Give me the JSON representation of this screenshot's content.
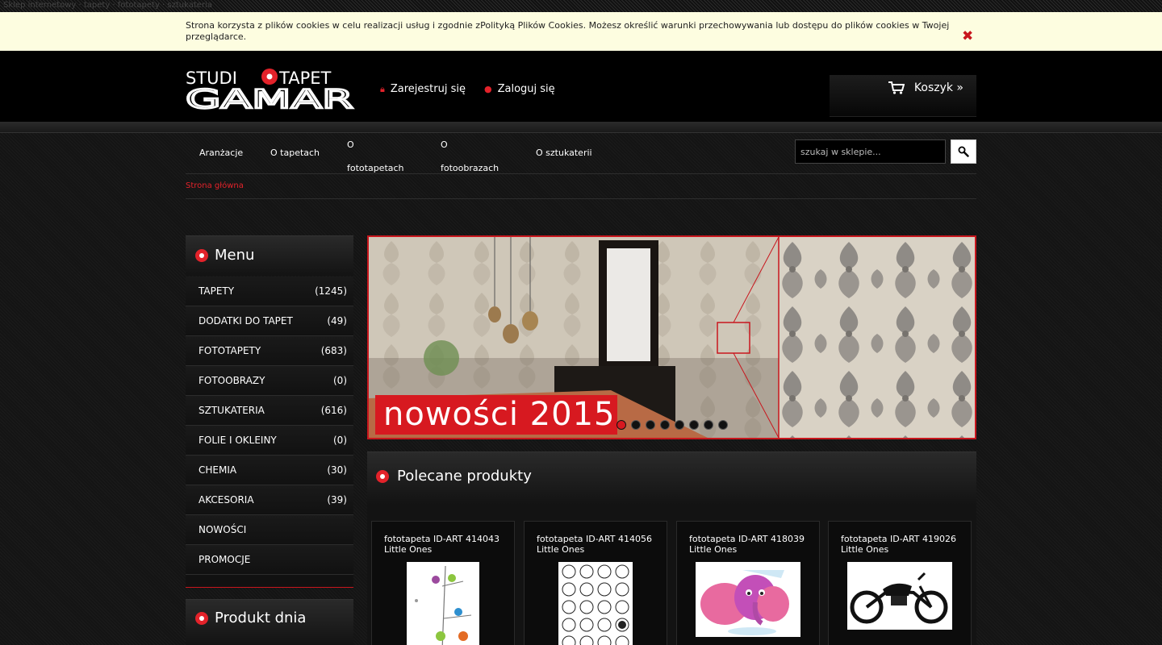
{
  "top_strip": {
    "text": "Sklep internetowy  ·  tapety  ·  fototapety  ·  sztukateria"
  },
  "cookie_bar": {
    "text_before": "Strona korzysta z plików cookies w celu realizacji usług i zgodnie z",
    "policy_link": "Polityką Plików Cookies",
    "text_after": ". Możesz określić warunki przechowywania lub dostępu do plików cookies w Twojej przeglądarce.",
    "close_icon": "close-icon",
    "close_glyph": "✖"
  },
  "header": {
    "logo_line1_left": "STUDI",
    "logo_line1_right": "TAPET",
    "logo_line2": "GAMAR",
    "register_label": "Zarejestruj się",
    "login_label": "Zaloguj się",
    "cart_label": "Koszyk »",
    "cart_icon": "cart-icon"
  },
  "nav": {
    "items": [
      {
        "label": "Aranżacje"
      },
      {
        "label": "O tapetach"
      },
      {
        "label_line1": "O",
        "label_line2": "fototapetach"
      },
      {
        "label_line1": "O",
        "label_line2": "fotoobrazach"
      },
      {
        "label": "O sztukaterii"
      }
    ]
  },
  "search": {
    "placeholder": "szukaj w sklepie...",
    "icon": "search-icon"
  },
  "breadcrumb": {
    "home": "Strona główna"
  },
  "sidebar": {
    "menu_title": "Menu",
    "items": [
      {
        "label": "TAPETY",
        "count": "(1245)"
      },
      {
        "label": "DODATKI DO TAPET",
        "count": "(49)"
      },
      {
        "label": "FOTOTAPETY",
        "count": "(683)"
      },
      {
        "label": "FOTOOBRAZY",
        "count": "(0)"
      },
      {
        "label": "SZTUKATERIA",
        "count": "(616)"
      },
      {
        "label": "FOLIE I OKLEINY",
        "count": "(0)"
      },
      {
        "label": "CHEMIA",
        "count": "(30)"
      },
      {
        "label": "AKCESORIA",
        "count": "(39)"
      },
      {
        "label": "NOWOŚCI",
        "count": ""
      },
      {
        "label": "PROMOCJE",
        "count": ""
      }
    ],
    "product_of_day_title": "Produkt dnia"
  },
  "banner": {
    "text": "nowości 2015",
    "slide_count": 8,
    "active_slide": 1
  },
  "featured": {
    "title": "Polecane produkty",
    "products": [
      {
        "title": "fototapeta ID-ART 414043 Little Ones"
      },
      {
        "title": "fototapeta ID-ART 414056 Little Ones"
      },
      {
        "title": "fototapeta ID-ART 418039 Little Ones"
      },
      {
        "title": "fototapeta ID-ART 419026 Little Ones"
      }
    ]
  },
  "colors": {
    "accent": "#e3222a",
    "cookie_bg": "#fdfde0",
    "background": "#151515"
  }
}
